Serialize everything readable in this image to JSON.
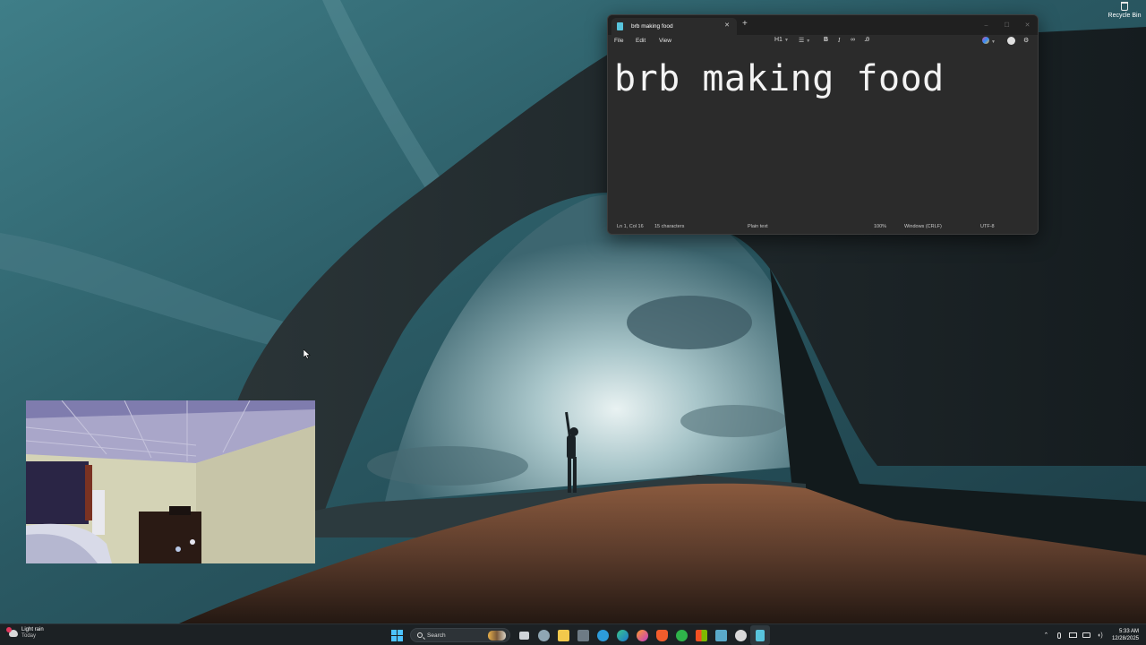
{
  "desktop": {
    "icons": [
      {
        "label": "Recycle Bin",
        "icon": "recycle-bin-icon"
      }
    ]
  },
  "notepad": {
    "tab_title": "brb making food",
    "tab_close_glyph": "✕",
    "new_tab_glyph": "+",
    "window_controls": [
      "–",
      "☐",
      "✕"
    ],
    "menu": [
      "File",
      "Edit",
      "View"
    ],
    "formatting": {
      "heading_label": "H1",
      "bold_label": "B",
      "italic_label": "I"
    },
    "content": "brb making food",
    "status": {
      "position": "Ln 1, Col 16",
      "characters": "15 characters",
      "format": "Plain text",
      "zoom": "100%",
      "line_endings": "Windows (CRLF)",
      "encoding": "UTF-8"
    }
  },
  "taskbar": {
    "weather": {
      "condition": "Light rain",
      "when": "Today",
      "icon": "rain-cloud-icon"
    },
    "search_placeholder": "Search",
    "pinned_apps": [
      "task-view",
      "settings",
      "file-explorer",
      "calculator",
      "cortana",
      "edge",
      "firefox",
      "brave",
      "xbox",
      "store",
      "files",
      "obs",
      "notepad"
    ],
    "tray": {
      "time": "5:33 AM",
      "date": "12/28/2025"
    }
  },
  "colors": {
    "accent": "#4cc2ff",
    "taskbar_bg": "#1c2124",
    "notepad_bg": "#2b2b2b"
  }
}
